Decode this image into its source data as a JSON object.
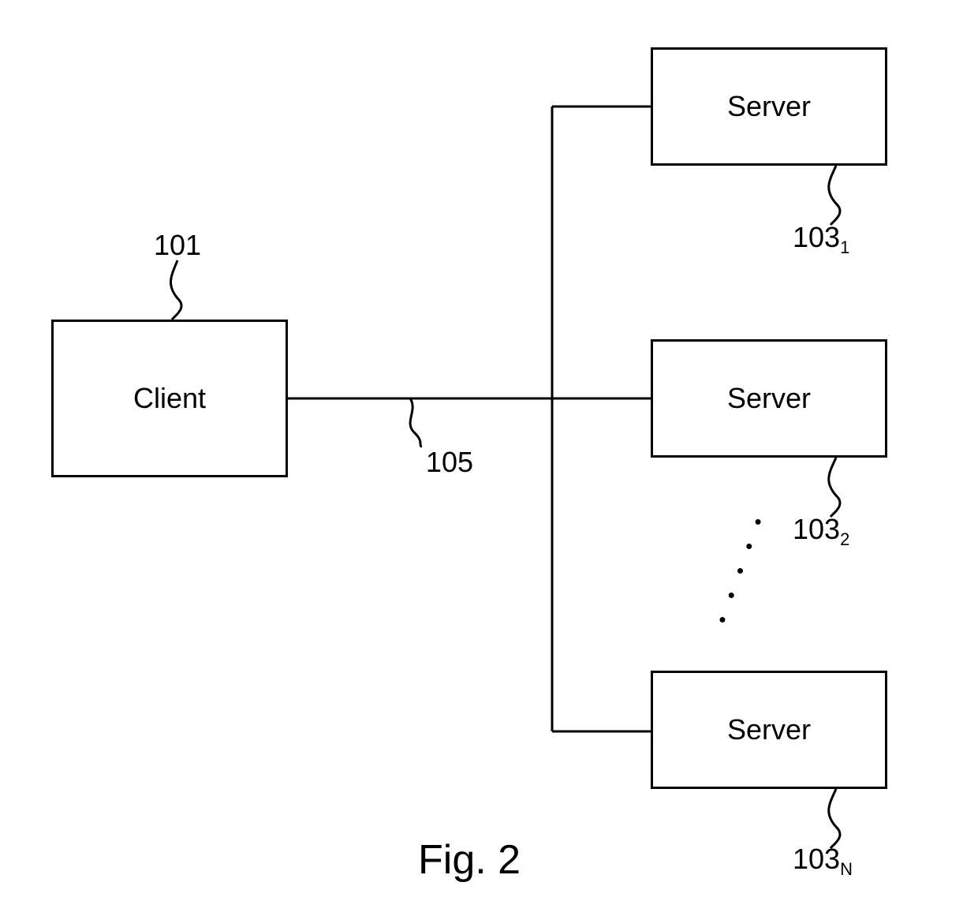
{
  "figure_caption": "Fig. 2",
  "nodes": {
    "client": {
      "label": "Client",
      "ref": "101"
    },
    "bus": {
      "ref": "105"
    },
    "servers": [
      {
        "label": "Server",
        "ref": "103",
        "subscript": "1"
      },
      {
        "label": "Server",
        "ref": "103",
        "subscript": "2"
      },
      {
        "label": "Server",
        "ref": "103",
        "subscript": "N"
      }
    ]
  }
}
